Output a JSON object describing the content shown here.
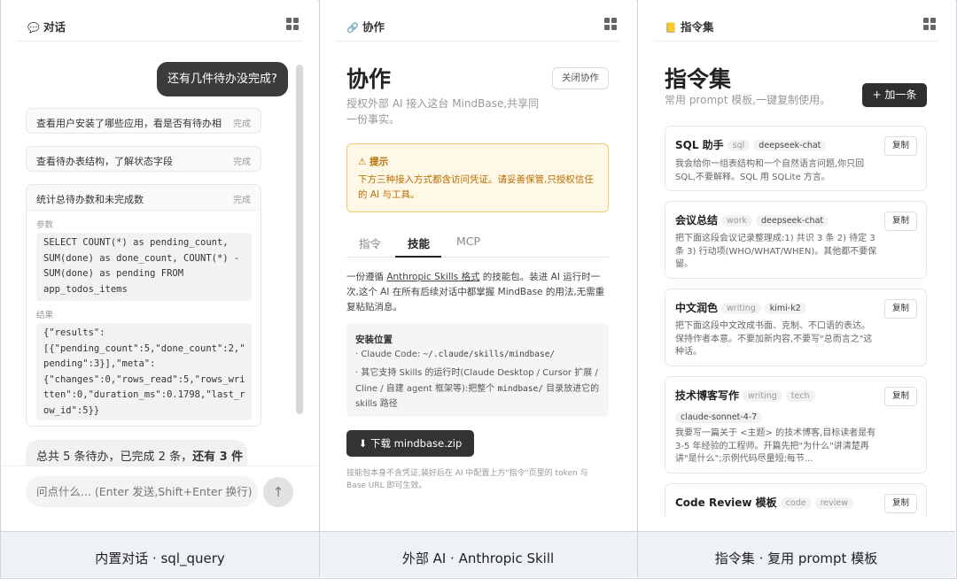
{
  "chat": {
    "title": "对话",
    "title_icon": "chat-bubble-icon",
    "user_message": "还有几件待办没完成?",
    "tools": [
      {
        "name": "查看用户安装了哪些应用，看是否有待办相...",
        "status": "完成"
      },
      {
        "name": "查看待办表结构，了解状态字段",
        "status": "完成"
      },
      {
        "name": "统计总待办数和未完成数",
        "status": "完成"
      }
    ],
    "params_label": "参数",
    "params_code": "SELECT COUNT(*) as pending_count,\nSUM(done) as done_count, COUNT(*) -\nSUM(done) as pending FROM\napp_todos_items",
    "result_label": "结果",
    "result_code": "{\"results\":\n[{\"pending_count\":5,\"done_count\":2,\"\npending\":3}],\"meta\":\n{\"changes\":0,\"rows_read\":5,\"rows_wri\ntten\":0,\"duration_ms\":0.1798,\"last_r\now_id\":5}}",
    "answer_prefix": "总共 5 条待办，已完成 2 条，",
    "answer_bold": "还有 3 件",
    "input_placeholder": "问点什么... (Enter 发送,Shift+Enter 换行)",
    "send_icon": "arrow-up-icon"
  },
  "collab": {
    "title": "协作",
    "title_icon": "link-icon",
    "heading": "协作",
    "close_label": "关闭协作",
    "subtitle": "授权外部 AI 接入这台 MindBase,共享同一份事实。",
    "warn_title": "⚠ 提示",
    "warn_body": "下方三种接入方式都含访问凭证。请妥善保管,只授权信任的 AI 与工具。",
    "tabs": [
      "指令",
      "技能",
      "MCP"
    ],
    "active_tab": "技能",
    "desc_prefix": "一份遵循 ",
    "desc_link": "Anthropic Skills 格式",
    "desc_suffix": " 的技能包。装进 AI 运行时一次,这个 AI 在所有后续对话中都掌握 MindBase 的用法,无需重复粘贴消息。",
    "install_title": "安装位置",
    "install_l1_prefix": "· Claude Code: ",
    "install_l1_path": "~/.claude/skills/mindbase/",
    "install_l2_prefix": "· 其它支持 Skills 的运行时(Claude Desktop / Cursor 扩展 / Cline / 自建 agent 框架等):把整个 ",
    "install_l2_path": "mindbase/",
    "install_l2_suffix": " 目录放进它的 skills 路径",
    "download_label": "⬇ 下载 mindbase.zip",
    "footnote": "技能包本身不含凭证,装好后在 AI 中配置上方\"指令\"页里的 token 与 Base URL 即可生效。"
  },
  "prompts": {
    "title": "指令集",
    "title_icon": "book-icon",
    "heading": "指令集",
    "subtitle": "常用 prompt 模板,一键复制使用。",
    "add_label": "+ 加一条",
    "copy_label": "复制",
    "cards": [
      {
        "title": "SQL 助手",
        "tags": [
          "sql"
        ],
        "model": "deepseek-chat",
        "body": "我会给你一组表结构和一个自然语言问题,你只回SQL,不要解释。SQL 用 SQLite 方言。"
      },
      {
        "title": "会议总结",
        "tags": [
          "work"
        ],
        "model": "deepseek-chat",
        "body": "把下面这段会议记录整理成:1) 共识 3 条 2) 待定 3 条 3) 行动项(WHO/WHAT/WHEN)。其他都不要保留。"
      },
      {
        "title": "中文润色",
        "tags": [
          "writing"
        ],
        "model": "kimi-k2",
        "body": "把下面这段中文改成书面、克制、不口语的表达。保持作者本意。不要加新内容,不要写\"总而言之\"这种话。"
      },
      {
        "title": "技术博客写作",
        "tags": [
          "writing",
          "tech"
        ],
        "model": "claude-sonnet-4-7",
        "body": "我要写一篇关于 <主题> 的技术博客,目标读者是有 3-5 年经验的工程师。开篇先把\"为什么\"讲清楚再讲\"是什么\";示例代码尽量短;每节..."
      },
      {
        "title": "Code Review 模板",
        "tags": [
          "code",
          "review"
        ],
        "model": "",
        "body": ""
      }
    ]
  },
  "captions": [
    "内置对话 · sql_query",
    "外部 AI · Anthropic Skill",
    "指令集 · 复用 prompt 模板"
  ]
}
